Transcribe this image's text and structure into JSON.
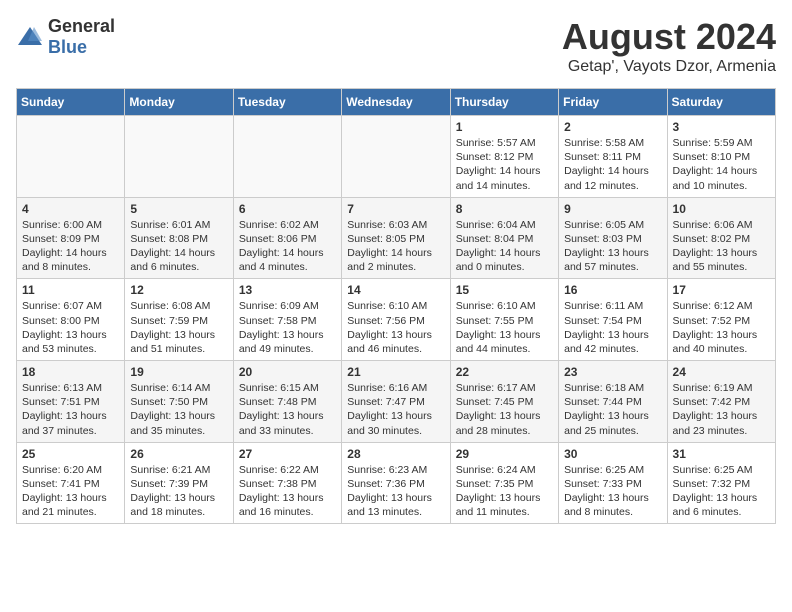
{
  "logo": {
    "general": "General",
    "blue": "Blue"
  },
  "title": "August 2024",
  "subtitle": "Getap', Vayots Dzor, Armenia",
  "weekdays": [
    "Sunday",
    "Monday",
    "Tuesday",
    "Wednesday",
    "Thursday",
    "Friday",
    "Saturday"
  ],
  "weeks": [
    [
      {
        "day": "",
        "info": ""
      },
      {
        "day": "",
        "info": ""
      },
      {
        "day": "",
        "info": ""
      },
      {
        "day": "",
        "info": ""
      },
      {
        "day": "1",
        "info": "Sunrise: 5:57 AM\nSunset: 8:12 PM\nDaylight: 14 hours and 14 minutes."
      },
      {
        "day": "2",
        "info": "Sunrise: 5:58 AM\nSunset: 8:11 PM\nDaylight: 14 hours and 12 minutes."
      },
      {
        "day": "3",
        "info": "Sunrise: 5:59 AM\nSunset: 8:10 PM\nDaylight: 14 hours and 10 minutes."
      }
    ],
    [
      {
        "day": "4",
        "info": "Sunrise: 6:00 AM\nSunset: 8:09 PM\nDaylight: 14 hours and 8 minutes."
      },
      {
        "day": "5",
        "info": "Sunrise: 6:01 AM\nSunset: 8:08 PM\nDaylight: 14 hours and 6 minutes."
      },
      {
        "day": "6",
        "info": "Sunrise: 6:02 AM\nSunset: 8:06 PM\nDaylight: 14 hours and 4 minutes."
      },
      {
        "day": "7",
        "info": "Sunrise: 6:03 AM\nSunset: 8:05 PM\nDaylight: 14 hours and 2 minutes."
      },
      {
        "day": "8",
        "info": "Sunrise: 6:04 AM\nSunset: 8:04 PM\nDaylight: 14 hours and 0 minutes."
      },
      {
        "day": "9",
        "info": "Sunrise: 6:05 AM\nSunset: 8:03 PM\nDaylight: 13 hours and 57 minutes."
      },
      {
        "day": "10",
        "info": "Sunrise: 6:06 AM\nSunset: 8:02 PM\nDaylight: 13 hours and 55 minutes."
      }
    ],
    [
      {
        "day": "11",
        "info": "Sunrise: 6:07 AM\nSunset: 8:00 PM\nDaylight: 13 hours and 53 minutes."
      },
      {
        "day": "12",
        "info": "Sunrise: 6:08 AM\nSunset: 7:59 PM\nDaylight: 13 hours and 51 minutes."
      },
      {
        "day": "13",
        "info": "Sunrise: 6:09 AM\nSunset: 7:58 PM\nDaylight: 13 hours and 49 minutes."
      },
      {
        "day": "14",
        "info": "Sunrise: 6:10 AM\nSunset: 7:56 PM\nDaylight: 13 hours and 46 minutes."
      },
      {
        "day": "15",
        "info": "Sunrise: 6:10 AM\nSunset: 7:55 PM\nDaylight: 13 hours and 44 minutes."
      },
      {
        "day": "16",
        "info": "Sunrise: 6:11 AM\nSunset: 7:54 PM\nDaylight: 13 hours and 42 minutes."
      },
      {
        "day": "17",
        "info": "Sunrise: 6:12 AM\nSunset: 7:52 PM\nDaylight: 13 hours and 40 minutes."
      }
    ],
    [
      {
        "day": "18",
        "info": "Sunrise: 6:13 AM\nSunset: 7:51 PM\nDaylight: 13 hours and 37 minutes."
      },
      {
        "day": "19",
        "info": "Sunrise: 6:14 AM\nSunset: 7:50 PM\nDaylight: 13 hours and 35 minutes."
      },
      {
        "day": "20",
        "info": "Sunrise: 6:15 AM\nSunset: 7:48 PM\nDaylight: 13 hours and 33 minutes."
      },
      {
        "day": "21",
        "info": "Sunrise: 6:16 AM\nSunset: 7:47 PM\nDaylight: 13 hours and 30 minutes."
      },
      {
        "day": "22",
        "info": "Sunrise: 6:17 AM\nSunset: 7:45 PM\nDaylight: 13 hours and 28 minutes."
      },
      {
        "day": "23",
        "info": "Sunrise: 6:18 AM\nSunset: 7:44 PM\nDaylight: 13 hours and 25 minutes."
      },
      {
        "day": "24",
        "info": "Sunrise: 6:19 AM\nSunset: 7:42 PM\nDaylight: 13 hours and 23 minutes."
      }
    ],
    [
      {
        "day": "25",
        "info": "Sunrise: 6:20 AM\nSunset: 7:41 PM\nDaylight: 13 hours and 21 minutes."
      },
      {
        "day": "26",
        "info": "Sunrise: 6:21 AM\nSunset: 7:39 PM\nDaylight: 13 hours and 18 minutes."
      },
      {
        "day": "27",
        "info": "Sunrise: 6:22 AM\nSunset: 7:38 PM\nDaylight: 13 hours and 16 minutes."
      },
      {
        "day": "28",
        "info": "Sunrise: 6:23 AM\nSunset: 7:36 PM\nDaylight: 13 hours and 13 minutes."
      },
      {
        "day": "29",
        "info": "Sunrise: 6:24 AM\nSunset: 7:35 PM\nDaylight: 13 hours and 11 minutes."
      },
      {
        "day": "30",
        "info": "Sunrise: 6:25 AM\nSunset: 7:33 PM\nDaylight: 13 hours and 8 minutes."
      },
      {
        "day": "31",
        "info": "Sunrise: 6:25 AM\nSunset: 7:32 PM\nDaylight: 13 hours and 6 minutes."
      }
    ]
  ]
}
